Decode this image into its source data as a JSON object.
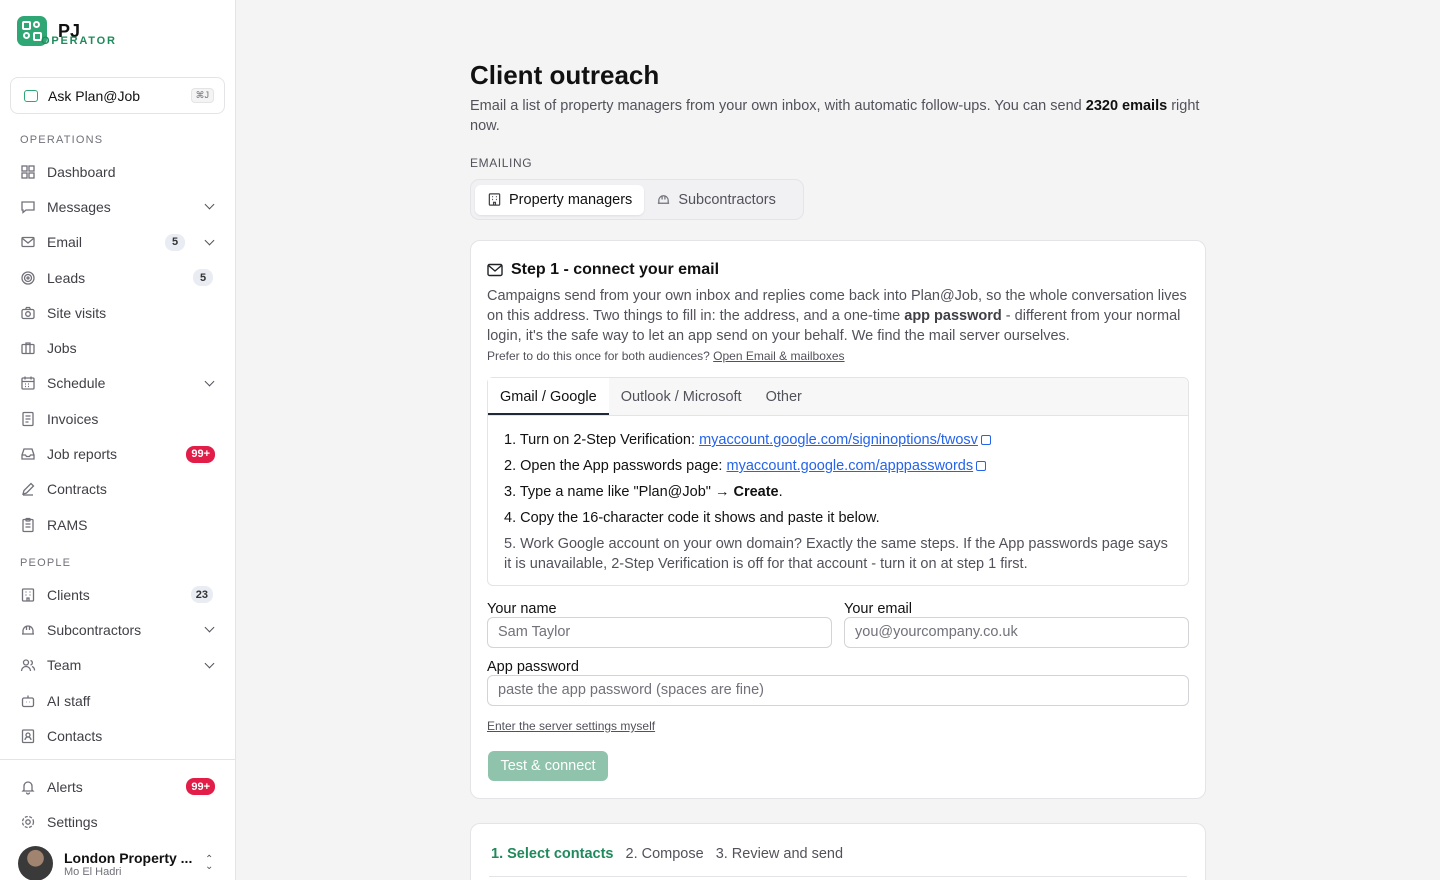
{
  "brand": {
    "name": "PJ",
    "subtitle": "OPERATOR"
  },
  "ask": {
    "label": "Ask Plan@Job",
    "shortcut": "⌘J"
  },
  "sidebar": {
    "section_operations": "OPERATIONS",
    "section_people": "PEOPLE",
    "operations": [
      {
        "label": "Dashboard",
        "icon": "dashboard-icon"
      },
      {
        "label": "Messages",
        "icon": "message-icon",
        "chevron": true
      },
      {
        "label": "Email",
        "icon": "mail-icon",
        "badge": "5",
        "chevron": true
      },
      {
        "label": "Leads",
        "icon": "target-icon",
        "badge": "5"
      },
      {
        "label": "Site visits",
        "icon": "camera-icon"
      },
      {
        "label": "Jobs",
        "icon": "briefcase-icon"
      },
      {
        "label": "Schedule",
        "icon": "calendar-icon",
        "chevron": true
      },
      {
        "label": "Invoices",
        "icon": "invoice-icon"
      },
      {
        "label": "Job reports",
        "icon": "inbox-icon",
        "badge": "99+"
      },
      {
        "label": "Contracts",
        "icon": "pen-icon"
      },
      {
        "label": "RAMS",
        "icon": "clipboard-icon"
      }
    ],
    "people": [
      {
        "label": "Clients",
        "icon": "building-icon",
        "badge": "23"
      },
      {
        "label": "Subcontractors",
        "icon": "hardhat-icon",
        "chevron": true
      },
      {
        "label": "Team",
        "icon": "users-icon",
        "chevron": true
      },
      {
        "label": "AI staff",
        "icon": "bot-icon"
      },
      {
        "label": "Contacts",
        "icon": "contact-icon"
      }
    ],
    "alerts": {
      "label": "Alerts",
      "badge": "99+"
    },
    "settings": {
      "label": "Settings"
    },
    "user": {
      "org": "London Property ...",
      "name": "Mo El Hadri"
    }
  },
  "page": {
    "title": "Client outreach",
    "desc_before": "Email a list of property managers from your own inbox, with automatic follow-ups. You can send ",
    "desc_bold": "2320 emails",
    "desc_after": " right now.",
    "emailing_label": "EMAILING",
    "segments": [
      "Property managers",
      "Subcontractors"
    ]
  },
  "step1": {
    "title": "Step 1 - connect your email",
    "desc_before": "Campaigns send from your own inbox and replies come back into Plan@Job, so the whole conversation lives on this address. Two things to fill in: the address, and a one-time ",
    "desc_bold": "app password",
    "desc_after": " - different from your normal login, it's the safe way to let an app send on your behalf. We find the mail server ourselves.",
    "prefer_text": "Prefer to do this once for both audiences? ",
    "prefer_link": "Open Email & mailboxes",
    "tabs": [
      "Gmail / Google",
      "Outlook / Microsoft",
      "Other"
    ],
    "steps": {
      "s1_text": "1. Turn on 2-Step Verification: ",
      "s1_link": "myaccount.google.com/signinoptions/twosv",
      "s2_text": "2. Open the App passwords page: ",
      "s2_link": "myaccount.google.com/apppasswords",
      "s3_before": "3. Type a name like \"Plan@Job\" → ",
      "s3_bold": "Create",
      "s3_after": ".",
      "s4": "4. Copy the 16-character code it shows and paste it below.",
      "s5": "5. Work Google account on your own domain? Exactly the same steps. If the App passwords page says it is unavailable, 2-Step Verification is off for that account - turn it on at step 1 first."
    },
    "form": {
      "name_label": "Your name",
      "name_placeholder": "Sam Taylor",
      "email_label": "Your email",
      "email_placeholder": "you@yourcompany.co.uk",
      "password_label": "App password",
      "password_placeholder": "paste the app password (spaces are fine)",
      "server_link": "Enter the server settings myself",
      "submit": "Test & connect"
    }
  },
  "wizard": {
    "steps": [
      "1. Select contacts",
      "2. Compose",
      "3. Review and send"
    ]
  }
}
